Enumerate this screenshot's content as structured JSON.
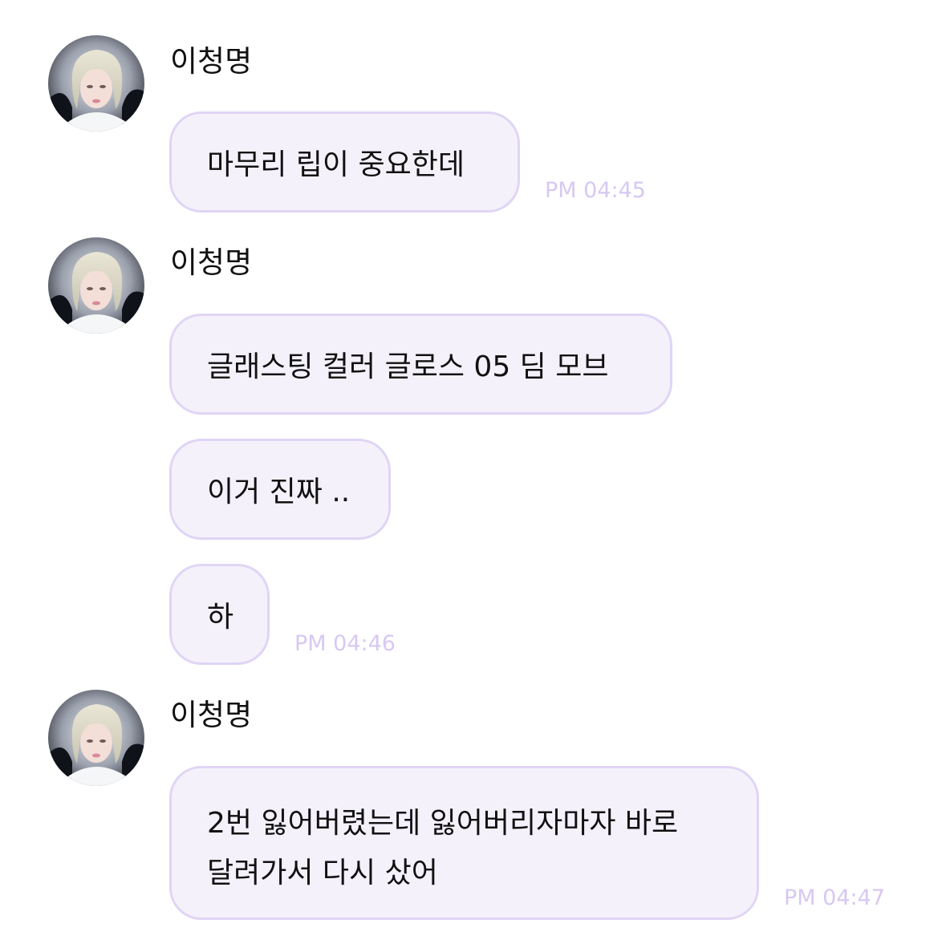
{
  "colors": {
    "bubble_fill": "#f4f1fb",
    "bubble_border": "#e0d5f5",
    "timestamp": "#d7c8f2",
    "text": "#111111",
    "background": "#ffffff"
  },
  "messages": [
    {
      "sender": "이청명",
      "avatar": "profile-photo",
      "bubbles": [
        {
          "text": "마무리 립이 중요한데"
        }
      ],
      "time": "PM 04:45"
    },
    {
      "sender": "이청명",
      "avatar": "profile-photo",
      "bubbles": [
        {
          "text": "글래스팅 컬러 글로스 05 딤 모브"
        },
        {
          "text": "이거 진짜 .."
        },
        {
          "text": "하"
        }
      ],
      "time": "PM 04:46"
    },
    {
      "sender": "이청명",
      "avatar": "profile-photo",
      "bubbles": [
        {
          "lines": [
            "2번 잃어버렸는데 잃어버리자마자 바로",
            "달려가서 다시 샀어"
          ]
        }
      ],
      "time": "PM 04:47"
    }
  ]
}
